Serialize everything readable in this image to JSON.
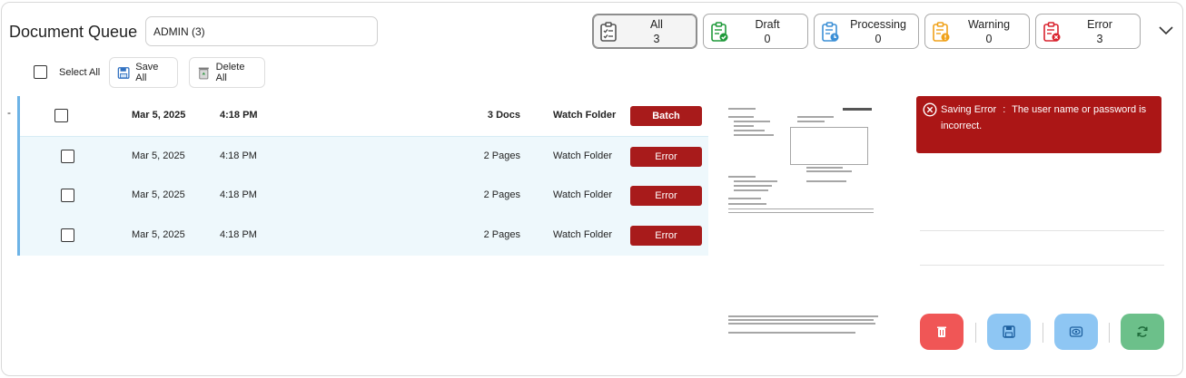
{
  "header": {
    "title": "Document Queue",
    "queue_value": "ADMIN (3)"
  },
  "filters": [
    {
      "label": "All",
      "count": "3",
      "icon": "clipboard-list-icon",
      "color": "#555555",
      "active": true
    },
    {
      "label": "Draft",
      "count": "0",
      "icon": "clipboard-check-icon",
      "color": "#1f9a3a"
    },
    {
      "label": "Processing",
      "count": "0",
      "icon": "clipboard-clock-icon",
      "color": "#3b8fd6"
    },
    {
      "label": "Warning",
      "count": "0",
      "icon": "clipboard-warning-icon",
      "color": "#f0a21a"
    },
    {
      "label": "Error",
      "count": "3",
      "icon": "clipboard-error-icon",
      "color": "#d9232e"
    }
  ],
  "toolbar": {
    "select_all_label": "Select All",
    "save_all_label": "Save All",
    "delete_all_label": "Delete All"
  },
  "rows": [
    {
      "date": "Mar 5, 2025",
      "time": "4:18 PM",
      "docs": "3 Docs",
      "source": "Watch Folder",
      "status": "Batch"
    },
    {
      "date": "Mar 5, 2025",
      "time": "4:18 PM",
      "docs": "2 Pages",
      "source": "Watch Folder",
      "status": "Error"
    },
    {
      "date": "Mar 5, 2025",
      "time": "4:18 PM",
      "docs": "2 Pages",
      "source": "Watch Folder",
      "status": "Error"
    },
    {
      "date": "Mar 5, 2025",
      "time": "4:18 PM",
      "docs": "2 Pages",
      "source": "Watch Folder",
      "status": "Error"
    }
  ],
  "error": {
    "title": "Saving Error",
    "separator": ":",
    "message": "The user name or password is incorrect."
  },
  "colors": {
    "status_red": "#a81b1b",
    "row_highlight": "#eef8fc",
    "accent_blue": "#6db3e6",
    "delete_button": "#f05656",
    "save_button": "#8ec6f3",
    "preview_button": "#8ec6f3",
    "refresh_button": "#6cc08a"
  }
}
